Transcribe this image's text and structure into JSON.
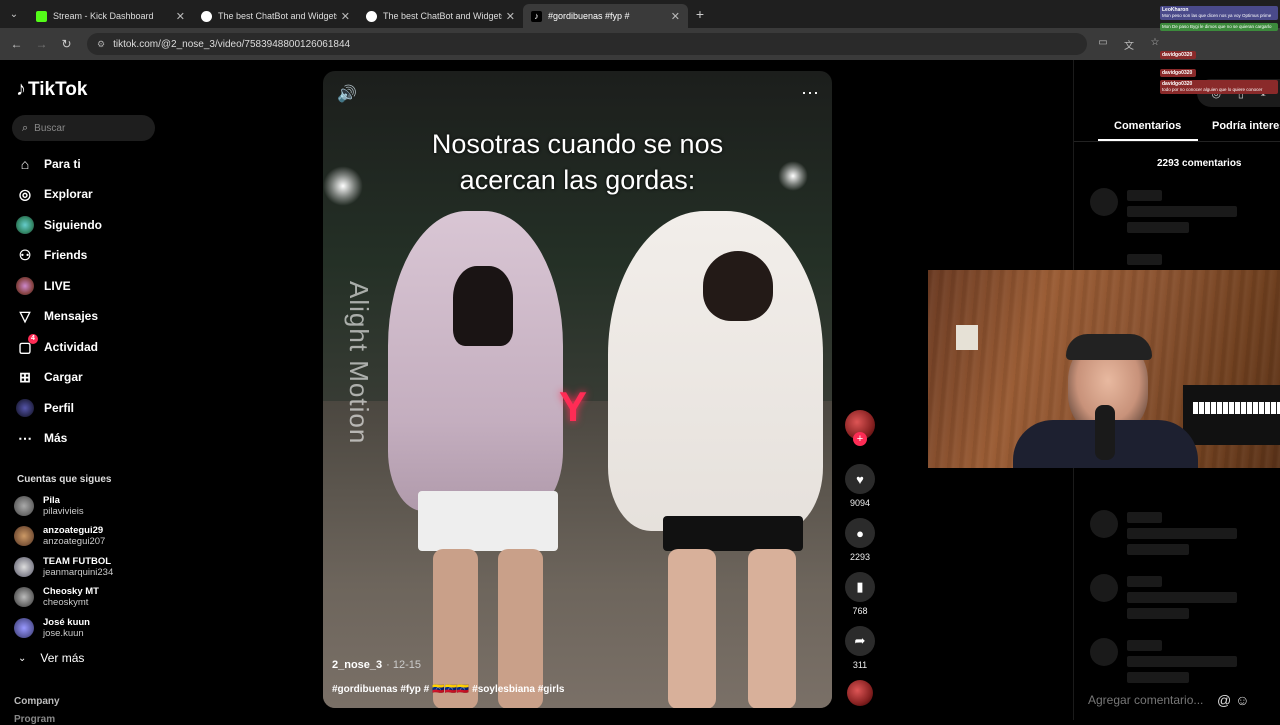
{
  "browser": {
    "tabs": [
      {
        "title": "Stream - Kick Dashboard",
        "color": "#53fc18",
        "active": false
      },
      {
        "title": "The best ChatBot and Widgets",
        "color": "#ffffff",
        "active": false
      },
      {
        "title": "The best ChatBot and Widgets",
        "color": "#ffffff",
        "active": false
      },
      {
        "title": "#gordibuenas #fyp #",
        "color": "#ffffff",
        "active": true
      }
    ],
    "url": "tiktok.com/@2_nose_3/video/7583948800126061844"
  },
  "sidebar": {
    "logo": "TikTok",
    "search_placeholder": "Buscar",
    "nav": [
      {
        "label": "Para ti",
        "icon": "home-icon"
      },
      {
        "label": "Explorar",
        "icon": "compass-icon"
      },
      {
        "label": "Siguiendo",
        "icon": "following-icon"
      },
      {
        "label": "Friends",
        "icon": "friends-icon"
      },
      {
        "label": "LIVE",
        "icon": "live-icon"
      },
      {
        "label": "Mensajes",
        "icon": "messages-icon"
      },
      {
        "label": "Actividad",
        "icon": "activity-icon",
        "badge": "4"
      },
      {
        "label": "Cargar",
        "icon": "upload-icon"
      },
      {
        "label": "Perfil",
        "icon": "profile-icon"
      },
      {
        "label": "Más",
        "icon": "more-icon"
      }
    ],
    "following_title": "Cuentas que sigues",
    "following": [
      {
        "name": "Pila",
        "handle": "pilavivieis"
      },
      {
        "name": "anzoategui29",
        "handle": "anzoategui207"
      },
      {
        "name": "TEAM FUTBOL",
        "handle": "jeanmarquini234"
      },
      {
        "name": "Cheosky MT",
        "handle": "cheoskymt"
      },
      {
        "name": "José kuun",
        "handle": "jose.kuun"
      }
    ],
    "see_more": "Ver más",
    "footer_company": "Company",
    "footer_program": "Program"
  },
  "video": {
    "caption_line1": "Nosotras cuando se nos",
    "caption_line2": "acercan las gordas:",
    "watermark": "Alight Motion",
    "overlay_letter": "Y",
    "username": "2_nose_3",
    "date": "· 12-15",
    "hashtags": "#gordibuenas #fyp # 🇻🇪🇻🇪🇻🇪 #soylesbiana #girls",
    "likes": "9094",
    "comments": "2293",
    "saves": "768",
    "shares": "311"
  },
  "comments_panel": {
    "tab_comments": "Comentarios",
    "tab_interest": "Podría interes",
    "count": "2293 comentarios",
    "input_placeholder": "Agregar comentario..."
  },
  "stream_chat": [
    {
      "user": "LeoKharon",
      "text": "Mon peso son las que dicen nos ya voy Optimus prime",
      "color": "#4a4a8a"
    },
    {
      "user": "",
      "text": "Mon De paso Bygi le dimos que no se quieran cargarlo",
      "color": "#3c8a3c"
    },
    {
      "user": "davidgo0320",
      "text": "",
      "color": "#8a2a2a"
    },
    {
      "user": "davidgo0320",
      "text": "",
      "color": "#8a2a2a"
    },
    {
      "user": "davidgo0320",
      "text": "todo por no conocer alguien que lo quiere conocer",
      "color": "#8a2a2a"
    }
  ]
}
